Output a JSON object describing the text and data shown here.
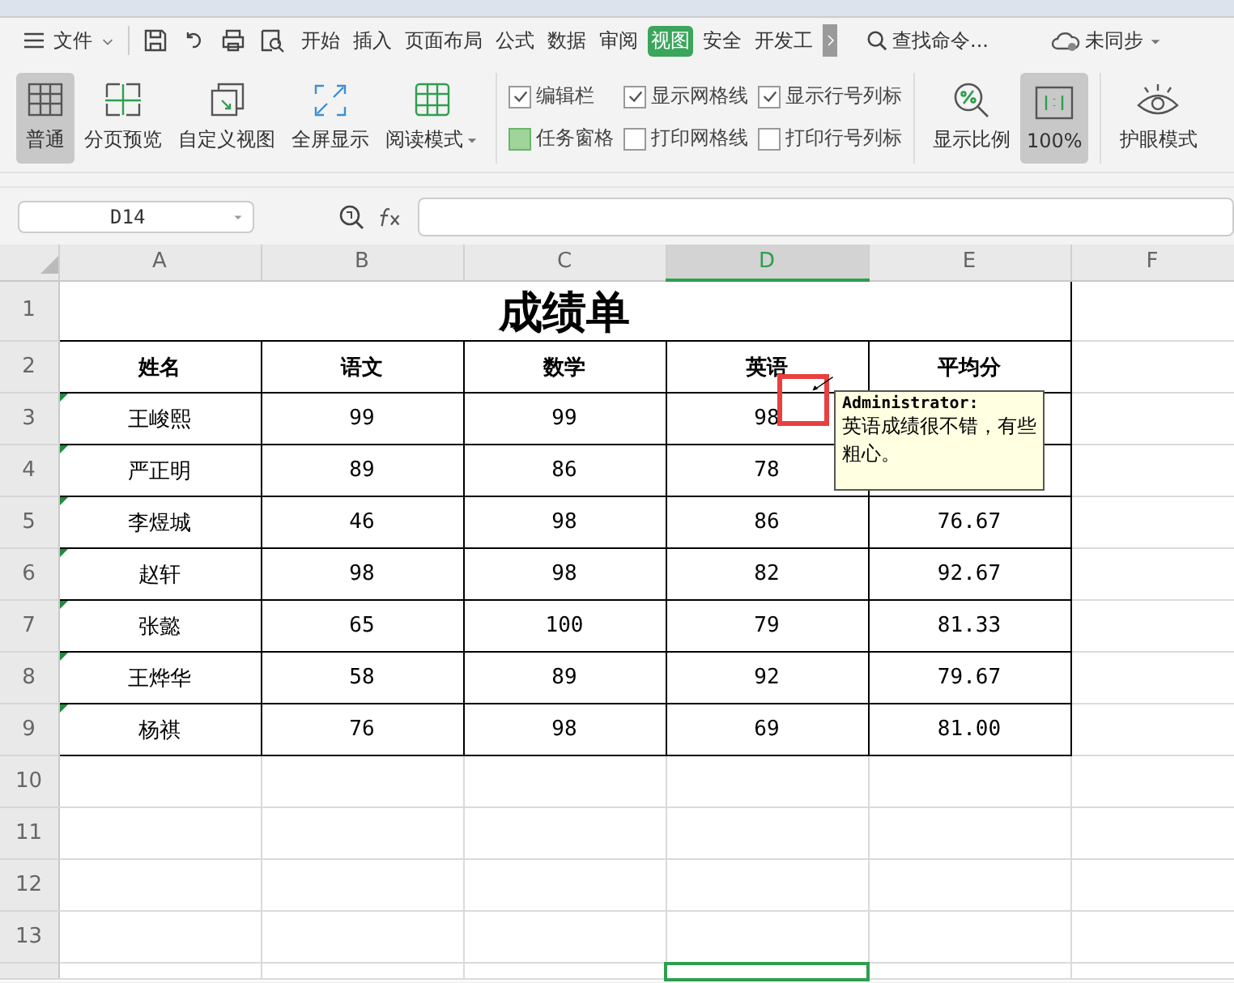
{
  "menu_bar": {
    "file_menu": "文件",
    "tabs": [
      {
        "label": "开始",
        "selected": false
      },
      {
        "label": "插入",
        "selected": false
      },
      {
        "label": "页面布局",
        "selected": false
      },
      {
        "label": "公式",
        "selected": false
      },
      {
        "label": "数据",
        "selected": false
      },
      {
        "label": "审阅",
        "selected": false
      },
      {
        "label": "视图",
        "selected": true
      },
      {
        "label": "安全",
        "selected": false
      },
      {
        "label": "开发工",
        "selected": false
      }
    ],
    "search": {
      "placeholder": "查找命令..."
    },
    "sync": "未同步"
  },
  "ribbon": {
    "view_buttons": [
      {
        "label": "普通",
        "kind": "normal",
        "selected": true
      },
      {
        "label": "分页预览",
        "kind": "page-break",
        "selected": false
      },
      {
        "label": "自定义视图",
        "kind": "custom",
        "selected": false
      },
      {
        "label": "全屏显示",
        "kind": "fullscreen",
        "selected": false
      },
      {
        "label": "阅读模式",
        "kind": "reading",
        "selected": false,
        "dropdown": true
      }
    ],
    "checkboxes": [
      {
        "label": "编辑栏",
        "kind": "tick",
        "checked": true
      },
      {
        "label": "任务窗格",
        "kind": "fill",
        "checked": true
      },
      {
        "label": "显示网格线",
        "kind": "tick",
        "checked": true
      },
      {
        "label": "打印网格线",
        "kind": "tick",
        "checked": false
      },
      {
        "label": "显示行号列标",
        "kind": "tick",
        "checked": true
      },
      {
        "label": "打印行号列标",
        "kind": "tick",
        "checked": false
      }
    ],
    "zoom_buttons": [
      {
        "label": "显示比例",
        "kind": "zoom",
        "selected": false
      },
      {
        "label": "100%",
        "kind": "actual",
        "selected": true
      },
      {
        "label": "护眼模式",
        "kind": "eye",
        "selected": false
      }
    ]
  },
  "formula_bar": {
    "name_box": "D14"
  },
  "sheet": {
    "columns": [
      {
        "label": "A",
        "selected": false
      },
      {
        "label": "B",
        "selected": false
      },
      {
        "label": "C",
        "selected": false
      },
      {
        "label": "D",
        "selected": true
      },
      {
        "label": "E",
        "selected": false
      },
      {
        "label": "F",
        "selected": false
      }
    ],
    "row_numbers": [
      "1",
      "2",
      "3",
      "4",
      "5",
      "6",
      "7",
      "8",
      "9",
      "10",
      "11",
      "12",
      "13"
    ],
    "title": "成绩单",
    "headers": [
      "姓名",
      "语文",
      "数学",
      "英语",
      "平均分"
    ],
    "rows": [
      {
        "name": "王峻熙",
        "values": [
          "99",
          "99",
          "98"
        ],
        "flag": true,
        "comment": true
      },
      {
        "name": "严正明",
        "values": [
          "89",
          "86",
          "78"
        ],
        "flag": true
      },
      {
        "name": "李煜城",
        "values": [
          "46",
          "98",
          "86",
          "76.67"
        ],
        "flag": true
      },
      {
        "name": "赵轩",
        "values": [
          "98",
          "98",
          "82",
          "92.67"
        ],
        "flag": true
      },
      {
        "name": "张懿",
        "values": [
          "65",
          "100",
          "79",
          "81.33"
        ],
        "flag": true
      },
      {
        "name": "王烨华",
        "values": [
          "58",
          "89",
          "92",
          "79.67"
        ],
        "flag": true
      },
      {
        "name": "杨祺",
        "values": [
          "76",
          "98",
          "69",
          "81.00"
        ],
        "flag": true
      }
    ],
    "comment_popup": {
      "author": "Administrator:",
      "text": "英语成绩很不错，有些粗心。"
    }
  }
}
